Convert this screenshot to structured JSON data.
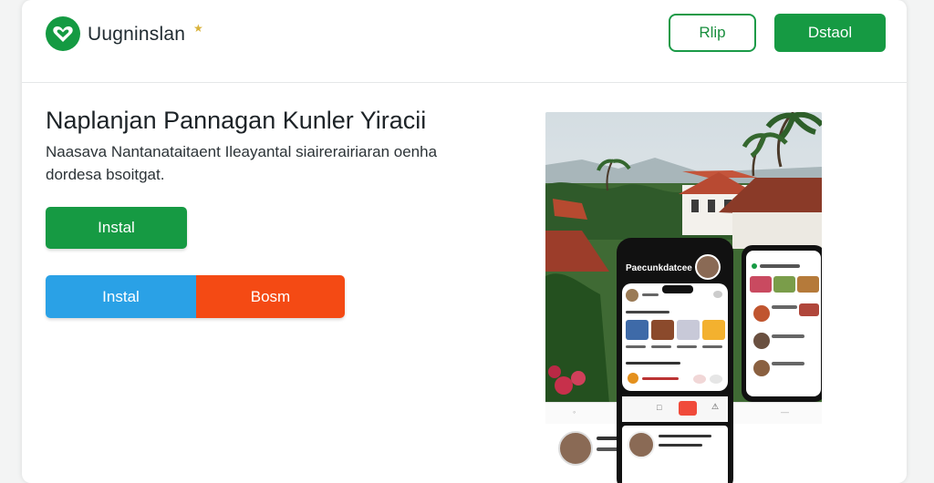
{
  "colors": {
    "primary_green": "#169a43",
    "blue": "#2aa1e6",
    "orange_red": "#f44a14"
  },
  "header": {
    "logo_icon": "heart-icon",
    "brand_name": "Uugninslan",
    "star_icon": "star-icon",
    "outline_button": "Rlip",
    "solid_button": "Dstaol"
  },
  "hero": {
    "title": "Naplanjan Pannagan Kunler Yiracii",
    "description": "Naasava Nantanataitaent Ileayantal siairerairiaran oenha dordesa bsoitgat.",
    "install_button": "Instal",
    "split_left": "Instal",
    "split_right": "Bosm"
  },
  "illustration": {
    "phone_header_text": "Paecunkdatcee",
    "icons": [
      "house-icon",
      "image-icon",
      "alert-icon"
    ]
  }
}
